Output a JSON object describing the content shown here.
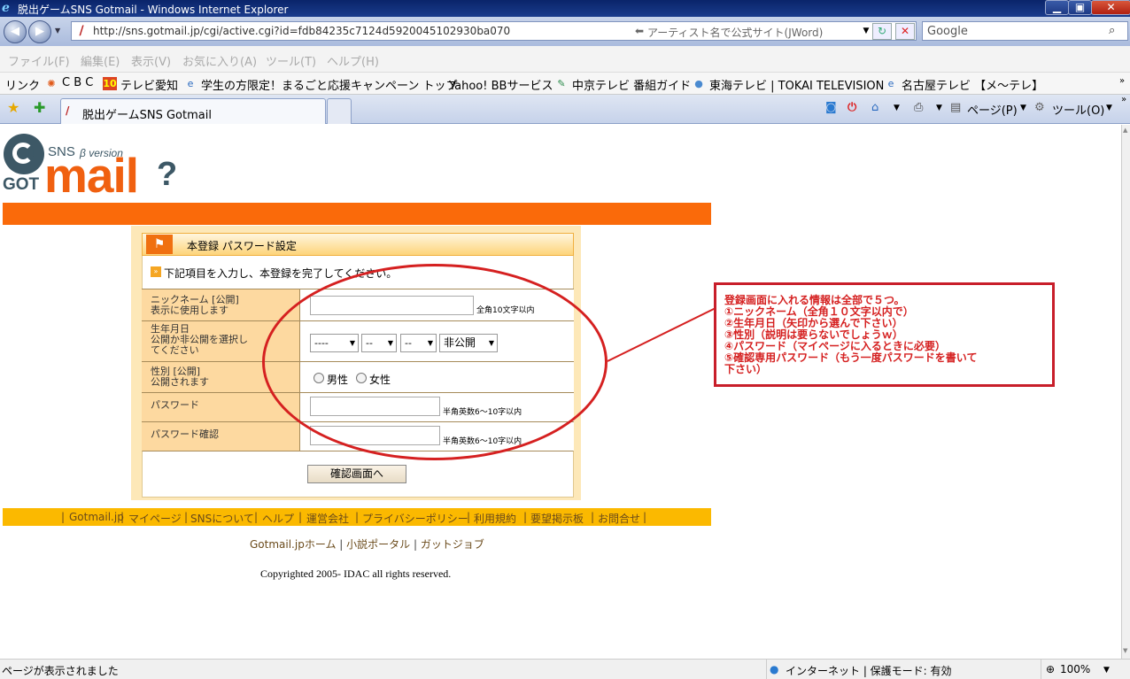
{
  "window": {
    "title": "脱出ゲームSNS Gotmail - Windows Internet Explorer",
    "minimize": "▁",
    "maximize": "▣",
    "close": "✕"
  },
  "address_bar": {
    "url": "http://sns.gotmail.jp/cgi/active.cgi?id=fdb84235c7124d5920045102930ba070",
    "jword_text": "アーティスト名で公式サイト(JWord)",
    "search_placeholder": "Google"
  },
  "menu": [
    "ファイル(F)",
    "編集(E)",
    "表示(V)",
    "お気に入り(A)",
    "ツール(T)",
    "ヘルプ(H)"
  ],
  "links_bar": {
    "label": "リンク",
    "items": [
      "C B C",
      "テレビ愛知",
      "学生の方限定！まるごと応援キャンペーン トップ",
      "Yahoo! BBサービス",
      "中京テレビ 番組ガイド",
      "東海テレビ | TOKAI TELEVISION",
      "名古屋テレビ 【メ～テレ】"
    ]
  },
  "tabs": {
    "active_title": "脱出ゲームSNS Gotmail",
    "page_menu": "ページ(P)",
    "tools_menu": "ツール(O)"
  },
  "logo": {
    "sns": "SNS",
    "beta": "β version",
    "got": "GOT",
    "mail": "mail",
    "q": "?"
  },
  "form": {
    "title": "本登録 パスワード設定",
    "instruction": "下記項目を入力し、本登録を完了してください。",
    "nickname_label": [
      "ニックネーム [公開]",
      "表示に使用します"
    ],
    "nickname_note": "全角10文字以内",
    "birthday_label": [
      "生年月日",
      "公開か非公開を選択し",
      "てください"
    ],
    "birthday_selects": [
      "----",
      "--",
      "--",
      "非公開"
    ],
    "gender_label": [
      "性別 [公開]",
      "公開されます"
    ],
    "gender_options": [
      "男性",
      "女性"
    ],
    "password_label": "パスワード",
    "password_note": "半角英数6～10字以内",
    "password_confirm_label": "パスワード確認",
    "password_confirm_note": "半角英数6～10字以内",
    "submit_label": "確認画面へ"
  },
  "footer": {
    "links": [
      "Gotmail.jp",
      "マイページ",
      "SNSについて",
      "ヘルプ",
      "運営会社",
      "プライバシーポリシー",
      "利用規約",
      "要望掲示板",
      "お問合せ"
    ],
    "links2": [
      "Gotmail.jpホーム",
      "小説ポータル",
      "ガットジョブ"
    ],
    "copyright": "Copyrighted 2005- IDAC all rights reserved."
  },
  "annotation": {
    "lines": [
      "登録画面に入れる情報は全部で５つ。",
      "①ニックネーム（全角１０文字以内で）",
      "②生年月日（矢印から選んで下さい）",
      "③性別（説明は要らないでしょうｗ）",
      "④パスワード（マイページに入るときに必要）",
      "⑤確認専用パスワード（もう一度パスワードを書いて",
      "下さい）"
    ]
  },
  "status": {
    "message": "ページが表示されました",
    "zone": "インターネット | 保護モード: 有効",
    "zoom": "100%"
  }
}
